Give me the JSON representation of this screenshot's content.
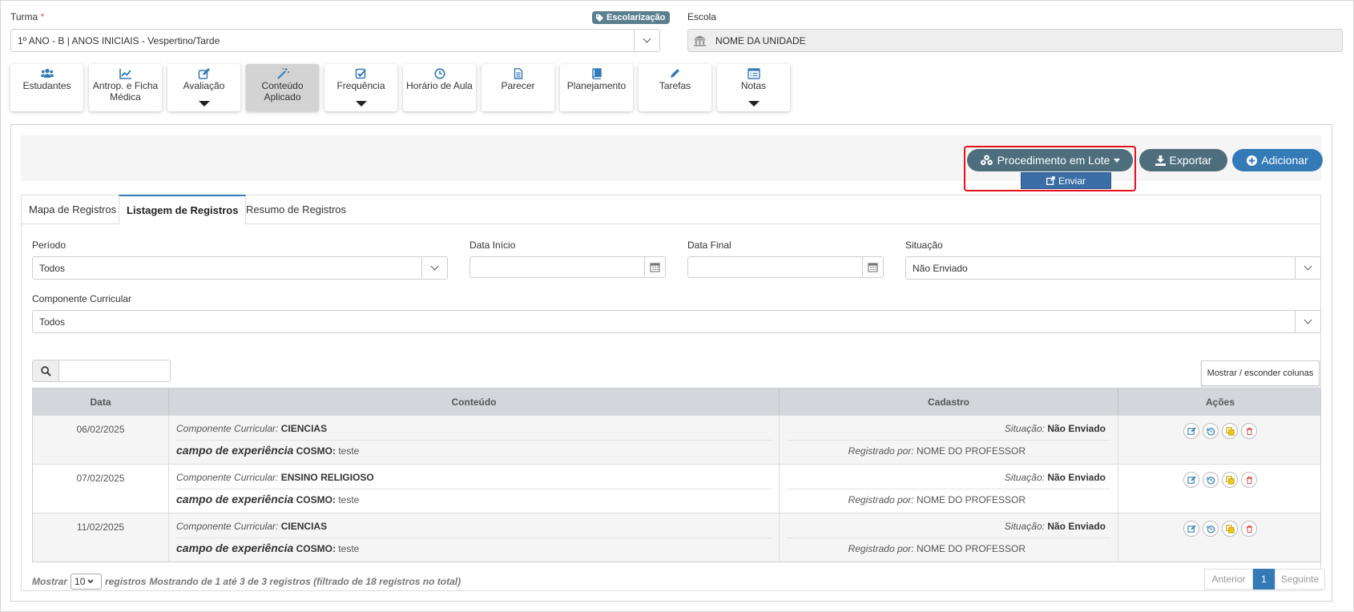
{
  "header": {
    "turma_label": "Turma",
    "turma_required": "*",
    "turma_value": "1º ANO - B | ANOS INICIAIS - Vespertino/Tarde",
    "escolarizacao_badge": "Escolarização",
    "escola_label": "Escola",
    "escola_value": "NOME DA UNIDADE"
  },
  "menu": [
    {
      "label": "Estudantes",
      "icon": "users-icon",
      "dropdown": false,
      "active": false
    },
    {
      "label": "Antrop. e Ficha Médica",
      "icon": "line-chart-icon",
      "dropdown": false,
      "active": false
    },
    {
      "label": "Avaliação",
      "icon": "edit-icon",
      "dropdown": true,
      "active": false
    },
    {
      "label": "Conteúdo Aplicado",
      "icon": "magic-wand-icon",
      "dropdown": false,
      "active": true
    },
    {
      "label": "Frequência",
      "icon": "check-square-icon",
      "dropdown": true,
      "active": false
    },
    {
      "label": "Horário de Aula",
      "icon": "clock-icon",
      "dropdown": false,
      "active": false
    },
    {
      "label": "Parecer",
      "icon": "file-text-icon",
      "dropdown": false,
      "active": false
    },
    {
      "label": "Planejamento",
      "icon": "book-icon",
      "dropdown": false,
      "active": false
    },
    {
      "label": "Tarefas",
      "icon": "pencil-icon",
      "dropdown": false,
      "active": false
    },
    {
      "label": "Notas",
      "icon": "list-alt-icon",
      "dropdown": true,
      "active": false
    }
  ],
  "toolbar": {
    "procedimento_label": "Procedimento em Lote",
    "enviar_label": "Enviar",
    "exportar_label": "Exportar",
    "adicionar_label": "Adicionar"
  },
  "tabs": [
    "Mapa de Registros",
    "Listagem de Registros",
    "Resumo de Registros"
  ],
  "filters": {
    "periodo_label": "Período",
    "periodo_value": "Todos",
    "data_inicio_label": "Data Início",
    "data_inicio_value": "",
    "data_final_label": "Data Final",
    "data_final_value": "",
    "situacao_label": "Situação",
    "situacao_value": "Não Enviado",
    "componente_label": "Componente Curricular",
    "componente_value": "Todos"
  },
  "search": {
    "value": ""
  },
  "columns_button": "Mostrar / esconder colunas",
  "table": {
    "headers": [
      "Data",
      "Conteúdo",
      "Cadastro",
      "Ações"
    ],
    "cc_label": "Componente Curricular:",
    "campo_label": "campo de experiência",
    "cosmo_label": "COSMO:",
    "situacao_label": "Situação:",
    "registrado_label": "Registrado por:",
    "rows": [
      {
        "date": "06/02/2025",
        "componente": "CIENCIAS",
        "cosmo": "teste",
        "situacao": "Não Enviado",
        "registrado": "NOME DO PROFESSOR"
      },
      {
        "date": "07/02/2025",
        "componente": "ENSINO RELIGIOSO",
        "cosmo": "teste",
        "situacao": "Não Enviado",
        "registrado": "NOME DO PROFESSOR"
      },
      {
        "date": "11/02/2025",
        "componente": "CIENCIAS",
        "cosmo": "teste",
        "situacao": "Não Enviado",
        "registrado": "NOME DO PROFESSOR"
      }
    ]
  },
  "footer": {
    "mostrar": "Mostrar",
    "page_size": "10",
    "registros": "registros",
    "info": "Mostrando de 1 até 3 de 3 registros (filtrado de 18 registros no total)",
    "anterior": "Anterior",
    "current_page": "1",
    "seguinte": "Seguinte"
  },
  "colors": {
    "accent": "#337ab7",
    "dark_button": "#4e6e7e",
    "highlight": "#e5101b"
  }
}
